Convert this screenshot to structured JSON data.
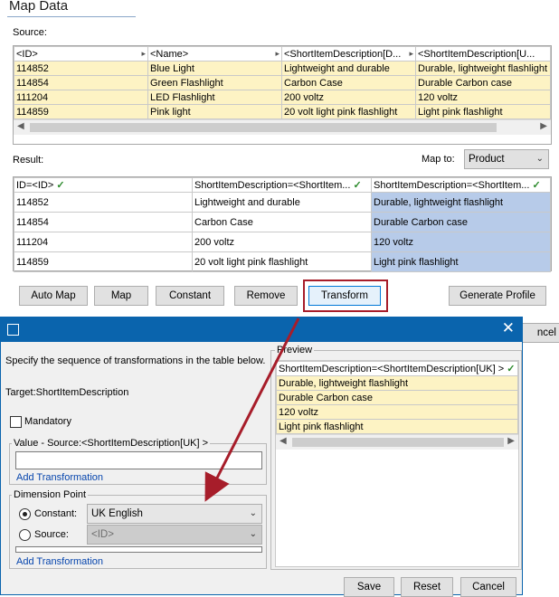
{
  "page": {
    "title": "Map Data",
    "source_label": "Source:",
    "result_label": "Result:",
    "map_to_label": "Map to:",
    "map_to_value": "Product"
  },
  "source_table": {
    "headers": [
      "<ID>",
      "<Name>",
      "<ShortItemDescription[D...",
      "<ShortItemDescription[U..."
    ],
    "rows": [
      [
        "114852",
        "Blue Light",
        "Lightweight and durable",
        "Durable, lightweight flashlight"
      ],
      [
        "114854",
        "Green Flashlight",
        "Carbon Case",
        "Durable Carbon case"
      ],
      [
        "111204",
        "LED Flashlight",
        "200 voltz",
        "120 voltz"
      ],
      [
        "114859",
        "Pink light",
        "20 volt light pink flashlight",
        "Light pink flashlight"
      ]
    ]
  },
  "result_table": {
    "headers": [
      "ID=<ID>",
      "ShortItemDescription=<ShortItem...",
      "ShortItemDescription=<ShortItem..."
    ],
    "check": "✓",
    "rows": [
      [
        "114852",
        "Lightweight and durable",
        "Durable, lightweight flashlight"
      ],
      [
        "114854",
        "Carbon Case",
        "Durable Carbon case"
      ],
      [
        "111204",
        "200 voltz",
        "120 voltz"
      ],
      [
        "114859",
        "20 volt light pink flashlight",
        "Light pink flashlight"
      ]
    ]
  },
  "buttons": {
    "auto_map": "Auto Map",
    "map": "Map",
    "constant": "Constant",
    "remove": "Remove",
    "transform": "Transform",
    "generate_profile": "Generate Profile",
    "cancel_partial": "ncel"
  },
  "dialog": {
    "instructions": "Specify the sequence of transformations in the table below.",
    "target": "Target:ShortItemDescription",
    "mandatory_label": "Mandatory",
    "value_group_label": "Value - Source:<ShortItemDescription[UK] >",
    "add_transformation_1": "Add Transformation",
    "dimension_group_label": "Dimension Point",
    "constant_label": "Constant:",
    "constant_value": "UK English",
    "source_label": "Source:",
    "source_value": "<ID>",
    "add_transformation_2": "Add Transformation",
    "preview_label": "Preview",
    "preview_header": "ShortItemDescription=<ShortItemDescription[UK] >",
    "preview_rows": [
      "Durable, lightweight flashlight",
      "Durable Carbon case",
      "120 voltz",
      "Light pink flashlight"
    ],
    "save": "Save",
    "reset": "Reset",
    "cancel": "Cancel",
    "close_glyph": "✕"
  },
  "colors": {
    "accent": "#0a64ad",
    "highlight_red": "#a71d2a",
    "source_row": "#fdf3c4",
    "mapped_column": "#b7cbe9"
  }
}
